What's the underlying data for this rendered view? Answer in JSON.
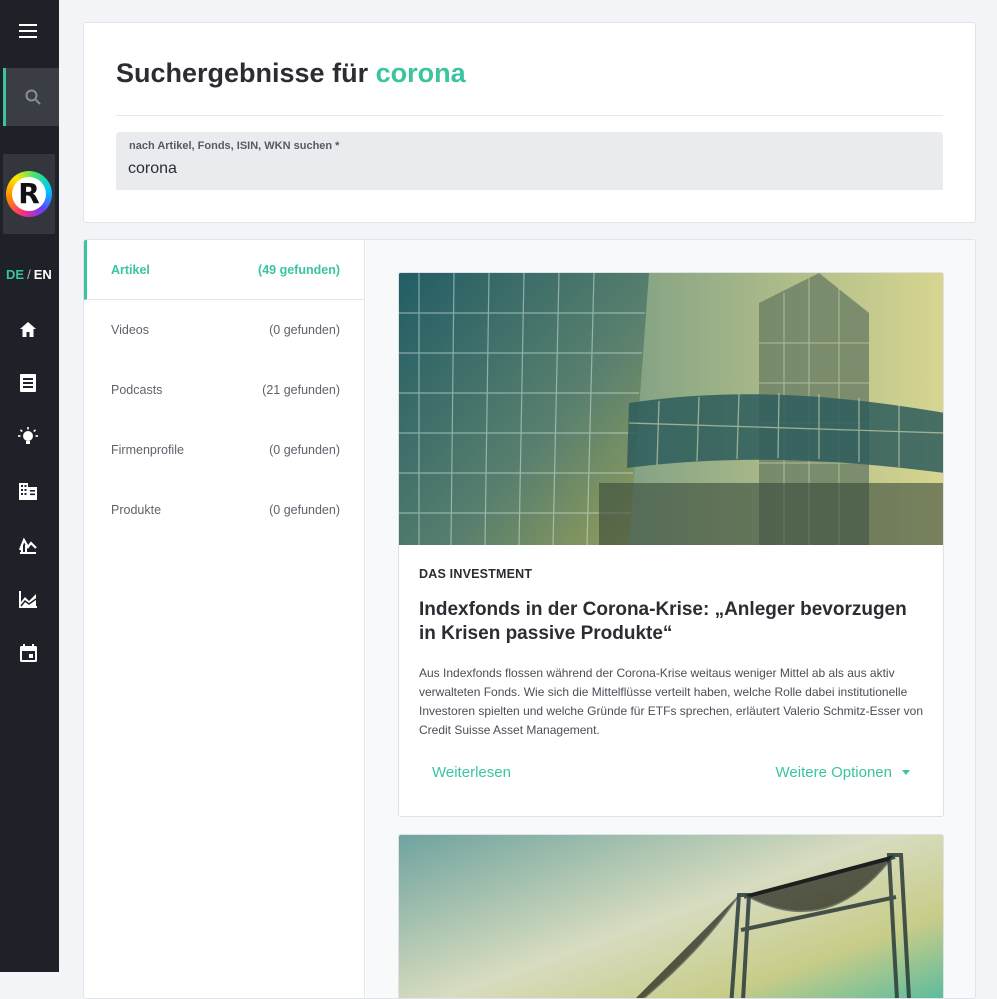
{
  "sidebar": {
    "lang_de": "DE",
    "lang_sep": "/",
    "lang_en": "EN",
    "logo_letter": "R",
    "icons": [
      "menu-icon",
      "search-icon",
      "home-icon",
      "news-icon",
      "lightbulb-icon",
      "company-icon",
      "chart-down-icon",
      "area-chart-icon",
      "calendar-icon"
    ]
  },
  "header": {
    "title_prefix": "Suchergebnisse für",
    "query": "corona",
    "search_label": "nach Artikel, Fonds, ISIN, WKN suchen *",
    "search_value": "corona"
  },
  "filters": [
    {
      "label": "Artikel",
      "count": "(49 gefunden)",
      "active": true
    },
    {
      "label": "Videos",
      "count": "(0 gefunden)",
      "active": false
    },
    {
      "label": "Podcasts",
      "count": "(21 gefunden)",
      "active": false
    },
    {
      "label": "Firmenprofile",
      "count": "(0 gefunden)",
      "active": false
    },
    {
      "label": "Produkte",
      "count": "(0 gefunden)",
      "active": false
    }
  ],
  "articles": [
    {
      "source": "DAS INVESTMENT",
      "title": "Indexfonds in der Corona-Krise: „Anleger bevorzugen in Krisen passive Produkte“",
      "text": "Aus Indexfonds flossen während der Corona-Krise weitaus weniger Mittel ab als aus aktiv verwalteten Fonds. Wie sich die Mittelflüsse verteilt haben, welche Rolle dabei institutionelle Investoren spielten und welche Gründe für ETFs sprechen, erläutert Valerio Schmitz-Esser von Credit Suisse Asset Management.",
      "read_more": "Weiterlesen",
      "more_options": "Weitere Optionen"
    }
  ],
  "colors": {
    "accent": "#3bc4a0",
    "sidebar": "#1e2128",
    "text": "#2b2d33"
  }
}
